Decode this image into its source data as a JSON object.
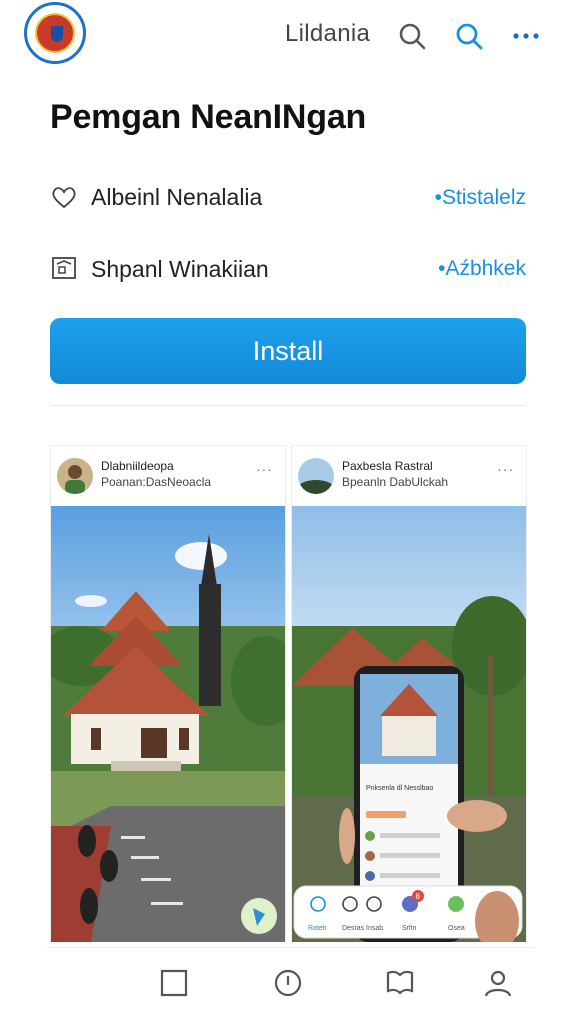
{
  "header": {
    "title": "Lildania",
    "icons": [
      "search-icon",
      "search-icon-active",
      "more-icon"
    ]
  },
  "page": {
    "title": "Pemgan NeanINgan"
  },
  "info_rows": [
    {
      "icon": "heart-icon",
      "label": "Albeinl Nenalalia",
      "link": "•Stistalelz"
    },
    {
      "icon": "building-icon",
      "label": "Shpanl Winakiian",
      "link": "•Aźbhkek"
    }
  ],
  "install": {
    "label": "Install"
  },
  "posts": [
    {
      "author": "Dlabniildeopa",
      "subtitle": "Poanan:DasNeoacla",
      "more": "···"
    },
    {
      "author": "Paxbesla Rastral",
      "subtitle": "Bpeanln DabUlckah",
      "more": "···"
    }
  ],
  "phone_ui": {
    "title": "Pnksenla dl Nesslbao",
    "tabs": [
      "Rateh",
      "Desras",
      "Insab",
      "Srltn",
      "Osea"
    ],
    "badge": "8"
  },
  "bottom_nav": [
    "square-icon",
    "compass-icon",
    "book-icon",
    "profile-icon"
  ],
  "colors": {
    "accent": "#1a8fdc",
    "install_button": "#1596e2",
    "roof": "#b5523a"
  }
}
